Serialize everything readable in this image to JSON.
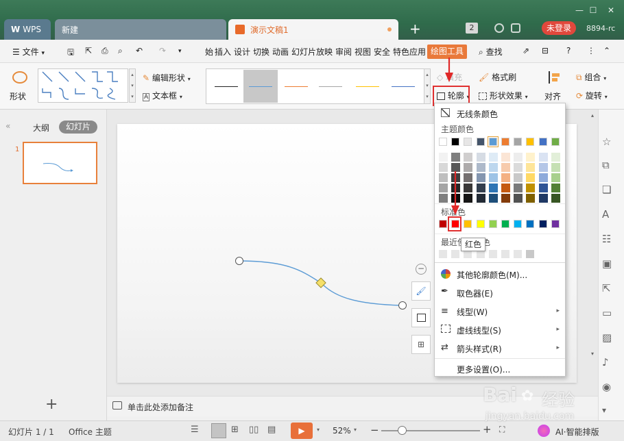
{
  "window": {
    "tabs": [
      {
        "label": "WPS"
      },
      {
        "label": "新建"
      },
      {
        "label": "演示文稿1"
      }
    ],
    "page_badge": "2",
    "login_label": "未登录",
    "user_id": "8894-rc"
  },
  "menu": {
    "file_label": "文件",
    "tabs": [
      "始",
      "插入",
      "设计",
      "切换",
      "动画",
      "幻灯片放映",
      "审阅",
      "视图",
      "安全",
      "特色应用"
    ],
    "active_tab": "绘图工具",
    "search_label": "查找"
  },
  "ribbon": {
    "shape_label": "形状",
    "edit_shape_label": "编辑形状",
    "textbox_label": "文本框",
    "fill_label": "填充",
    "format_brush_label": "格式刷",
    "outline_label": "轮廓",
    "shape_effect_label": "形状效果",
    "align_label": "对齐",
    "group_label": "组合",
    "rotate_label": "旋转",
    "line_colors": [
      "#222222",
      "#5b9bd5",
      "#ed7d31",
      "#a5a5a5",
      "#ffc000",
      "#4472c4"
    ]
  },
  "left_pane": {
    "outline_tab": "大纲",
    "slides_tab": "幻灯片",
    "slide_number": "1"
  },
  "notes": {
    "placeholder": "单击此处添加备注"
  },
  "status": {
    "slide_info": "幻灯片 1 / 1",
    "theme": "Office 主题",
    "zoom": "52%",
    "ai_label": "AI·智能排版"
  },
  "outline_menu": {
    "no_line": "无线条颜色",
    "theme_colors_title": "主题颜色",
    "theme_top": [
      "#ffffff",
      "#000000",
      "#e7e6e6",
      "#44546a",
      "#5b9bd5",
      "#ed7d31",
      "#a5a5a5",
      "#ffc000",
      "#4472c4",
      "#70ad47"
    ],
    "theme_shades": [
      [
        "#f2f2f2",
        "#7f7f7f",
        "#d0cece",
        "#d6dce4",
        "#deebf6",
        "#fbe5d5",
        "#ededed",
        "#fff2cc",
        "#dae3f3",
        "#e2efd9"
      ],
      [
        "#d8d8d8",
        "#595959",
        "#aeabab",
        "#adb9ca",
        "#bdd7ee",
        "#f7cbac",
        "#dbdbdb",
        "#fee599",
        "#b4c6e7",
        "#c5e0b3"
      ],
      [
        "#bfbfbf",
        "#3f3f3f",
        "#757070",
        "#8496b0",
        "#9dc3e6",
        "#f4b183",
        "#c9c9c9",
        "#ffd965",
        "#8eaadb",
        "#a8d08d"
      ],
      [
        "#a5a5a5",
        "#262626",
        "#3a3838",
        "#333f4f",
        "#2e75b5",
        "#c55a11",
        "#7b7b7b",
        "#bf9000",
        "#2f5496",
        "#538135"
      ],
      [
        "#7f7f7f",
        "#0c0c0c",
        "#171616",
        "#222a35",
        "#1e4e79",
        "#833c0b",
        "#525252",
        "#7f6000",
        "#1f3864",
        "#375623"
      ]
    ],
    "standard_title": "标准色",
    "standard_colors": [
      "#c00000",
      "#ff0000",
      "#ffc000",
      "#ffff00",
      "#92d050",
      "#00b050",
      "#00b0f0",
      "#0070c0",
      "#002060",
      "#7030a0"
    ],
    "recent_title": "最近使用颜色",
    "recent_colors": [
      "#e6e6e6",
      "#e6e6e6",
      "#e6e6e6",
      "#e6e6e6",
      "#e6e6e6",
      "#e6e6e6",
      "#e6e6e6",
      "#c8c8c8"
    ],
    "tooltip": "红色",
    "more_colors": "其他轮廓颜色(M)...",
    "eyedropper": "取色器(E)",
    "line_type": "线型(W)",
    "dash_type": "虚线线型(S)",
    "arrow_style": "箭头样式(R)",
    "more_settings": "更多设置(O)..."
  },
  "watermark": {
    "brand": "Bai",
    "brand_suffix": "经验",
    "url": "jingyan.baidu.com"
  }
}
